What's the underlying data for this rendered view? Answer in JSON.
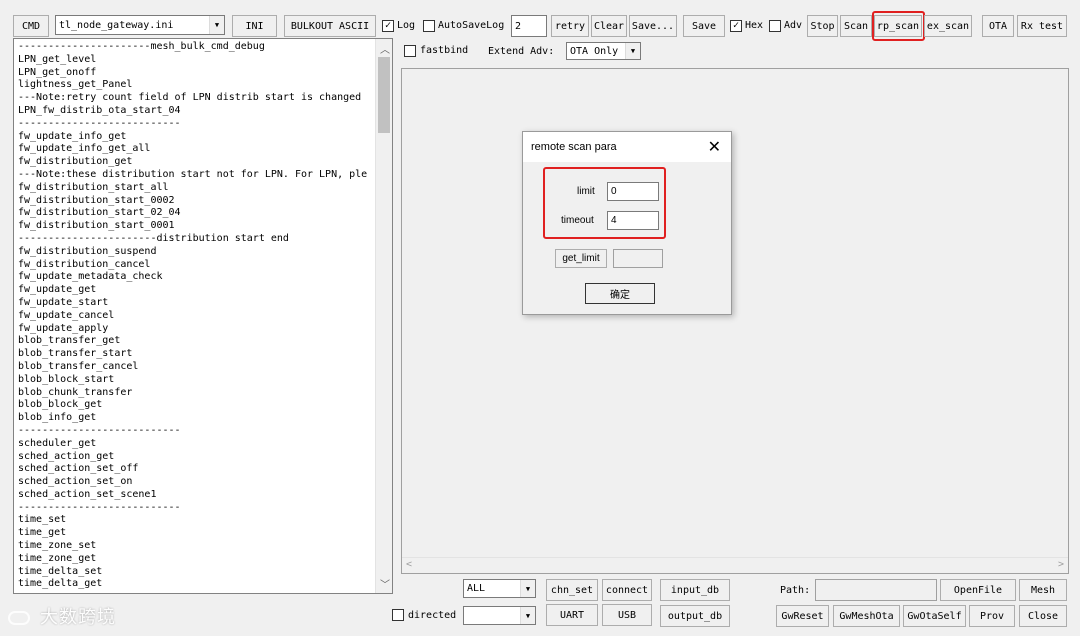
{
  "toolbar": {
    "cmd_label": "CMD",
    "ini_file": "tl_node_gateway.ini",
    "ini_label": "INI",
    "bulkout_label": "BULKOUT ASCII",
    "log_label": "Log",
    "log_checked": "✓",
    "autosave_label": "AutoSaveLog",
    "autosave_value": "2",
    "retry_label": "retry",
    "clear_label": "Clear",
    "save_dots_label": "Save...",
    "save_label": "Save",
    "hex_label": "Hex",
    "hex_checked": "✓",
    "adv_label": "Adv",
    "stop_label": "Stop",
    "scan_label": "Scan",
    "rp_scan_label": "rp_scan",
    "ex_scan_label": "ex_scan",
    "ota_label": "OTA",
    "rx_test_label": "Rx test"
  },
  "options": {
    "fastbind_label": "fastbind",
    "extend_adv_label": "Extend Adv:",
    "extend_adv_value": "OTA Only"
  },
  "commands": [
    "----------------------mesh_bulk_cmd_debug",
    "LPN_get_level",
    "LPN_get_onoff",
    "lightness_get_Panel",
    "---Note:retry count field of LPN distrib start is changed",
    "LPN_fw_distrib_ota_start_04",
    "---------------------------",
    "fw_update_info_get",
    "fw_update_info_get_all",
    "fw_distribution_get",
    "---Note:these distribution start not for LPN. For LPN, ple",
    "fw_distribution_start_all",
    "fw_distribution_start_0002",
    "fw_distribution_start_02_04",
    "fw_distribution_start_0001",
    "-----------------------distribution start end",
    "fw_distribution_suspend",
    "fw_distribution_cancel",
    "fw_update_metadata_check",
    "fw_update_get",
    "fw_update_start",
    "fw_update_cancel",
    "fw_update_apply",
    "blob_transfer_get",
    "blob_transfer_start",
    "blob_transfer_cancel",
    "blob_block_start",
    "blob_chunk_transfer",
    "blob_block_get",
    "blob_info_get",
    "---------------------------",
    "scheduler_get",
    "sched_action_get",
    "sched_action_set_off",
    "sched_action_set_on",
    "sched_action_set_scene1",
    "---------------------------",
    "time_set",
    "time_get",
    "time_zone_set",
    "time_zone_get",
    "time_delta_set",
    "time_delta_get"
  ],
  "dialog": {
    "title": "remote scan para",
    "limit_label": "limit",
    "limit_value": "0",
    "timeout_label": "timeout",
    "timeout_value": "4",
    "get_limit_label": "get_limit",
    "get_limit_result": "",
    "ok_label": "确定"
  },
  "bottom": {
    "all_value": "ALL",
    "chn_set_label": "chn_set",
    "connect_label": "connect",
    "input_db_label": "input_db",
    "path_label": "Path:",
    "path_value": "",
    "openfile_label": "OpenFile",
    "mesh_label": "Mesh",
    "directed_label": "directed",
    "directed_value": "",
    "uart_label": "UART",
    "usb_label": "USB",
    "output_db_label": "output_db",
    "gwreset_label": "GwReset",
    "gwmeshota_label": "GwMeshOta",
    "gwotaself_label": "GwOtaSelf",
    "prov_label": "Prov",
    "close_label": "Close"
  },
  "watermark": "大数跨境",
  "colors": {
    "highlight": "#e02020",
    "background": "#f0f0f0"
  }
}
